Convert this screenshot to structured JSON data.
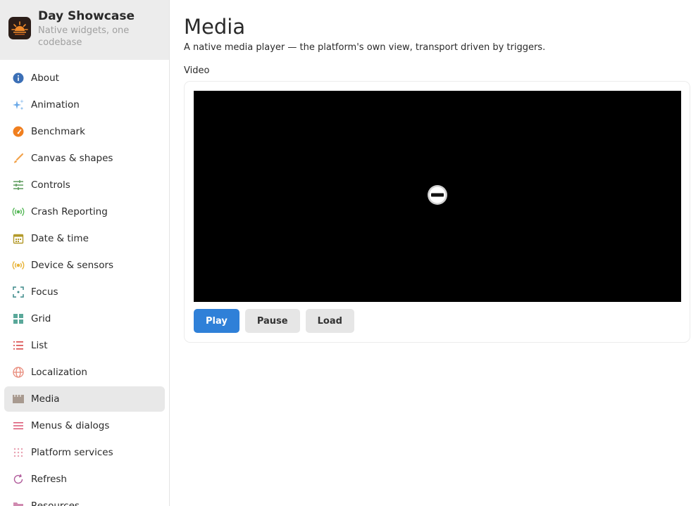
{
  "app": {
    "title": "Day Showcase",
    "subtitle": "Native widgets, one codebase"
  },
  "sidebar": {
    "items": [
      {
        "label": "About",
        "icon": "info-icon",
        "color": "#3b6fb6"
      },
      {
        "label": "Animation",
        "icon": "sparkle-icon",
        "color": "#6aa9e8"
      },
      {
        "label": "Benchmark",
        "icon": "speedometer-icon",
        "color": "#f07f1f"
      },
      {
        "label": "Canvas & shapes",
        "icon": "brush-icon",
        "color": "#f2a24a"
      },
      {
        "label": "Controls",
        "icon": "sliders-icon",
        "color": "#5a9a5a"
      },
      {
        "label": "Crash Reporting",
        "icon": "broadcast-icon",
        "color": "#58b85a"
      },
      {
        "label": "Date & time",
        "icon": "calendar-icon",
        "color": "#b39a2a"
      },
      {
        "label": "Device & sensors",
        "icon": "sensor-icon",
        "color": "#e8b43a"
      },
      {
        "label": "Focus",
        "icon": "focus-icon",
        "color": "#3d8a8a"
      },
      {
        "label": "Grid",
        "icon": "grid-icon",
        "color": "#5aa89a"
      },
      {
        "label": "List",
        "icon": "list-icon",
        "color": "#d94a4a"
      },
      {
        "label": "Localization",
        "icon": "globe-icon",
        "color": "#e88a7a"
      },
      {
        "label": "Media",
        "icon": "film-icon",
        "color": "#a89a90"
      },
      {
        "label": "Menus & dialogs",
        "icon": "menu-icon",
        "color": "#d94a6a"
      },
      {
        "label": "Platform services",
        "icon": "dots-grid-icon",
        "color": "#e8a0b0"
      },
      {
        "label": "Refresh",
        "icon": "refresh-icon",
        "color": "#b05a9a"
      },
      {
        "label": "Resources",
        "icon": "folder-icon",
        "color": "#d08ab0"
      }
    ],
    "active": "Media"
  },
  "main": {
    "title": "Media",
    "description": "A native media player — the platform's own view, transport driven by triggers.",
    "section_label": "Video",
    "buttons": {
      "play": "Play",
      "pause": "Pause",
      "load": "Load"
    }
  },
  "colors": {
    "accent": "#2f80d8",
    "sidebar_header": "#ececec",
    "active_item": "#e8e8e8"
  }
}
